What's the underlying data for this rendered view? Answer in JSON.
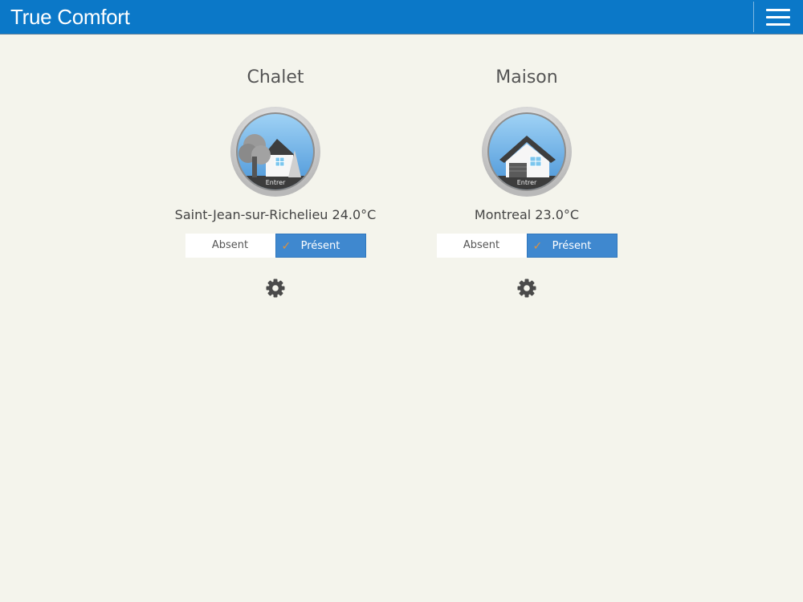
{
  "header": {
    "title": "True Comfort",
    "menu_icon": "hamburger-menu-icon"
  },
  "locations": [
    {
      "name": "Chalet",
      "enter_label": "Entrer",
      "info": "Saint-Jean-sur-Richelieu 24.0°C",
      "absent_label": "Absent",
      "present_label": "Présent",
      "selected": "Présent",
      "settings_icon": "gear-icon"
    },
    {
      "name": "Maison",
      "enter_label": "Entrer",
      "info": "Montreal 23.0°C",
      "absent_label": "Absent",
      "present_label": "Présent",
      "selected": "Présent",
      "settings_icon": "gear-icon"
    }
  ],
  "colors": {
    "header": "#0b78c8",
    "background": "#f4f4ec",
    "selected_toggle": "#3f88cf",
    "check": "#e1913c"
  }
}
